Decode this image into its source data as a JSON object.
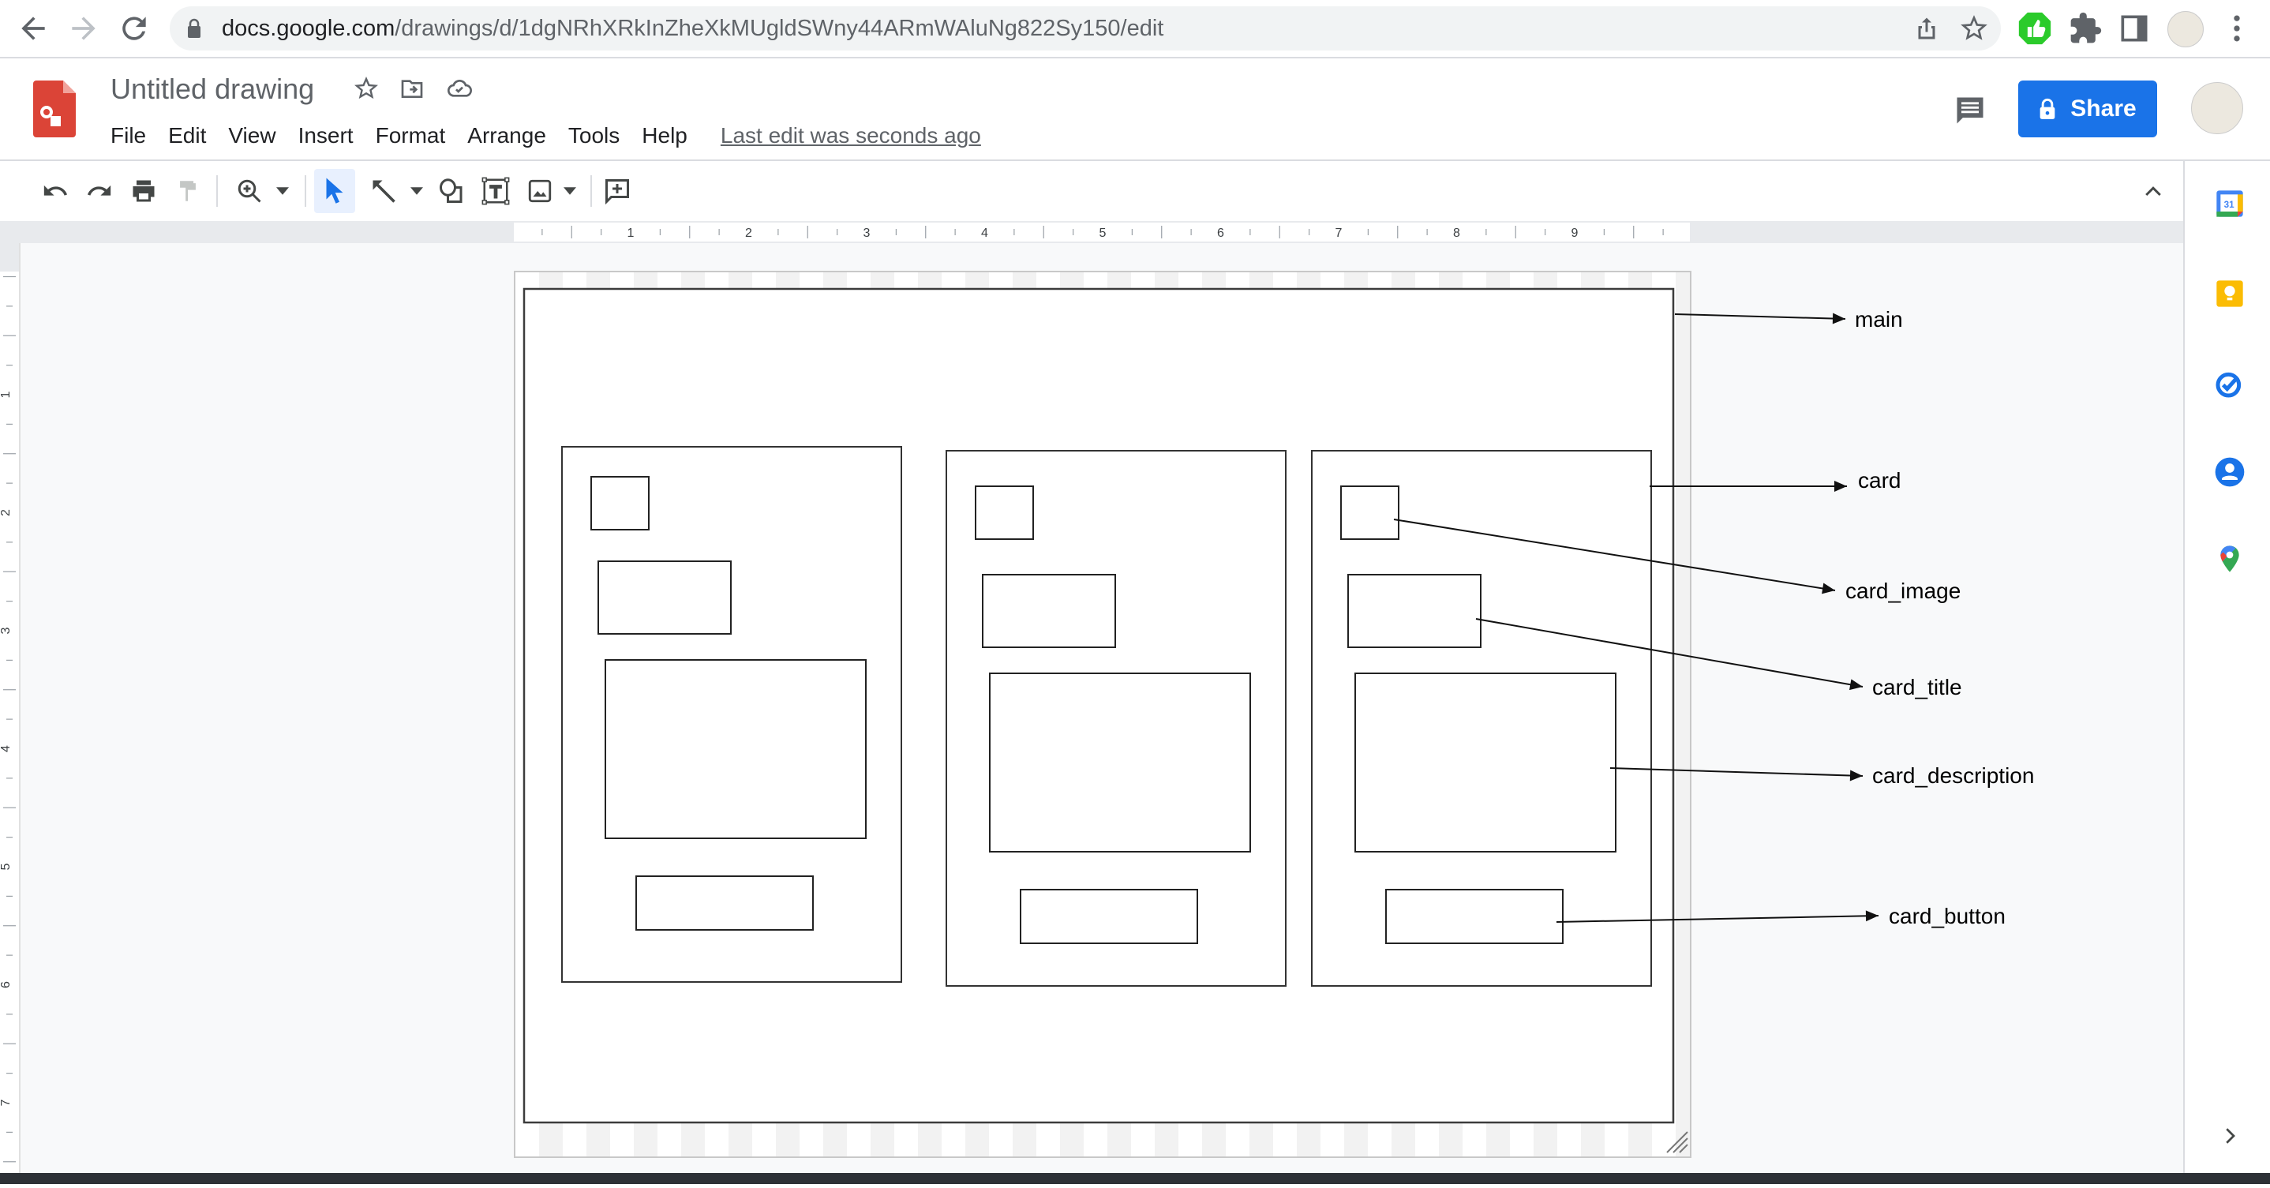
{
  "browser": {
    "url_host": "docs.google.com",
    "url_path": "/drawings/d/1dgNRhXRkInZheXkMUgldSWny44ARmWAluNg822Sy150/edit",
    "nav": {
      "back": "arrow-left-icon",
      "forward": "arrow-right-icon",
      "reload": "reload-icon"
    },
    "icons": [
      "share-page-icon",
      "bookmark-star-icon",
      "thumbs-up-extension-icon",
      "extensions-puzzle-icon",
      "side-panel-icon",
      "profile-avatar",
      "more-vert-icon"
    ]
  },
  "header": {
    "title": "Untitled drawing",
    "menus": [
      "File",
      "Edit",
      "View",
      "Insert",
      "Format",
      "Arrange",
      "Tools",
      "Help"
    ],
    "last_edit": "Last edit was seconds ago",
    "share_label": "Share",
    "brand_color": "#1a73e8",
    "logo_color": "#db4437"
  },
  "toolbar": {
    "tools": [
      "undo",
      "redo",
      "print",
      "paint-format",
      "zoom",
      "select",
      "line",
      "shape",
      "text-box",
      "image",
      "add-comment"
    ],
    "active_tool": "select"
  },
  "rulers": {
    "horizontal": [
      "1",
      "2",
      "3",
      "4",
      "5",
      "6",
      "7",
      "8",
      "9"
    ],
    "vertical": [
      "1",
      "2",
      "3",
      "4",
      "5",
      "6",
      "7"
    ]
  },
  "drawing": {
    "labels": [
      "main",
      "card",
      "card_image",
      "card_title",
      "card_description",
      "card_button"
    ],
    "card_count": 3
  },
  "sidebar": {
    "apps": [
      "Calendar",
      "Keep",
      "Tasks",
      "Contacts",
      "Maps"
    ],
    "calendar_day": "31"
  }
}
